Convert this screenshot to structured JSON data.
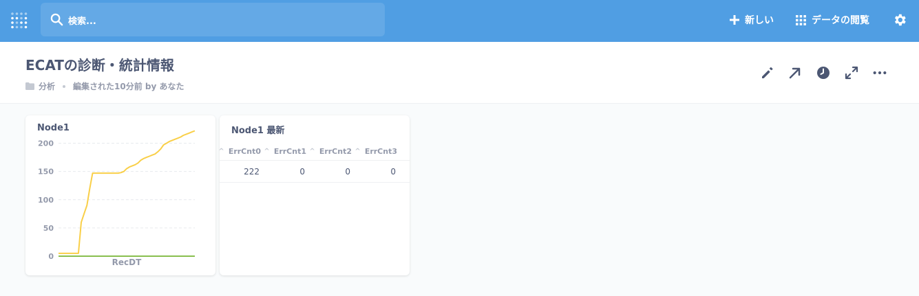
{
  "navbar": {
    "search_placeholder": "検索...",
    "new_label": "新しい",
    "browse_label": "データの閲覧",
    "bg_color": "#509ee3"
  },
  "header": {
    "title": "ECATの診断・統計情報",
    "collection": "分析",
    "edited": "編集された10分前 by あなた"
  },
  "cards": {
    "node1": {
      "title": "Node1",
      "chart_data": {
        "type": "line",
        "xlabel": "RecDT",
        "ylabel": "",
        "ylim": [
          0,
          225
        ],
        "yticks": [
          "0",
          "50",
          "100",
          "150",
          "200"
        ],
        "grid": true,
        "series": [
          {
            "color": "#f9cf48",
            "values": [
              5,
              5,
              5,
              5,
              5,
              5,
              5,
              5,
              60,
              75,
              90,
              120,
              147,
              147,
              147,
              147,
              147,
              147,
              147,
              147,
              147,
              147,
              148,
              150,
              155,
              158,
              160,
              162,
              165,
              170,
              173,
              175,
              177,
              179,
              181,
              185,
              190,
              197,
              200,
              203,
              205,
              207,
              209,
              211,
              214,
              216,
              218,
              220,
              222
            ]
          },
          {
            "color": "#88bf4d",
            "values": [
              0,
              0,
              0,
              0,
              0,
              0,
              0,
              0,
              0,
              0,
              0,
              0,
              0,
              0,
              0,
              0,
              0,
              0,
              0,
              0,
              0,
              0,
              0,
              0,
              0,
              0,
              0,
              0,
              0,
              0,
              0,
              0,
              0,
              0,
              0,
              0,
              0,
              0,
              0,
              0,
              0,
              0,
              0,
              0,
              0,
              0,
              0,
              0,
              0
            ]
          }
        ]
      }
    },
    "node1_latest": {
      "title": "Node1 最新",
      "columns": [
        "ErrCnt0",
        "ErrCnt1",
        "ErrCnt2",
        "ErrCnt3"
      ],
      "rows": [
        [
          "222",
          "0",
          "0",
          "0"
        ]
      ]
    }
  }
}
